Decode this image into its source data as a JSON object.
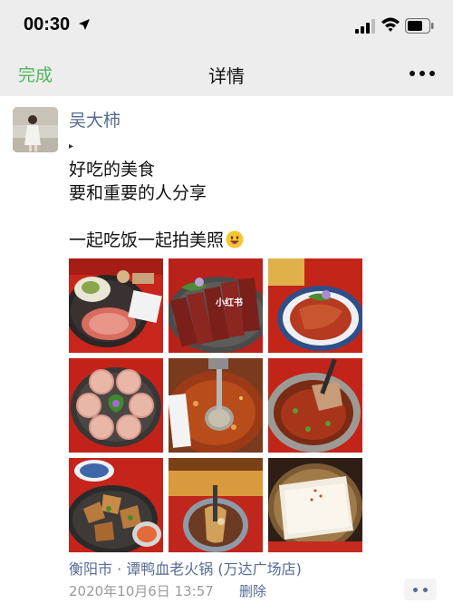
{
  "status_bar": {
    "time": "00:30",
    "icons": [
      "location-arrow-icon",
      "cellular-signal-icon",
      "wifi-icon",
      "battery-icon"
    ]
  },
  "nav": {
    "done_label": "完成",
    "title": "详情",
    "more_icon": "more-dots-icon"
  },
  "post": {
    "author": "吴大柿",
    "bullet": "▸",
    "lines": [
      "好吃的美食",
      "要和重要的人分享",
      "一起吃饭一起拍美照"
    ],
    "emoji": "grinning-face-emoji",
    "photos": [
      {
        "name": "photo-platter-meat-sauce"
      },
      {
        "name": "photo-duck-blood-slices",
        "watermark": "小红书"
      },
      {
        "name": "photo-spiced-dish-blue-plate"
      },
      {
        "name": "photo-radish-cakes"
      },
      {
        "name": "photo-hotpot-ladle"
      },
      {
        "name": "photo-bowl-chili-pieces"
      },
      {
        "name": "photo-stir-fried-dish"
      },
      {
        "name": "photo-noodle-bowl-closeup"
      },
      {
        "name": "photo-tofu-skin-basket"
      }
    ],
    "location": "衡阳市 · 谭鸭血老火锅 (万达广场店)",
    "timestamp": "2020年10月6日 13:57",
    "delete_label": "删除"
  },
  "colors": {
    "link": "#576b95",
    "accent": "#4fb55a",
    "bar_bg": "#ededed"
  }
}
